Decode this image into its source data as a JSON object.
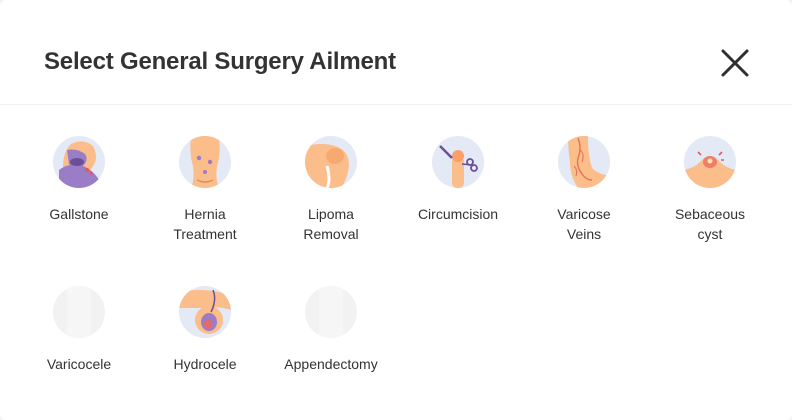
{
  "modal": {
    "title": "Select General Surgery Ailment",
    "close_icon": "close-icon"
  },
  "ailments": [
    {
      "label_lines": [
        "Gallstone"
      ],
      "icon": "gallstone-icon"
    },
    {
      "label_lines": [
        "Hernia",
        "Treatment"
      ],
      "icon": "hernia-icon"
    },
    {
      "label_lines": [
        "Lipoma",
        "Removal"
      ],
      "icon": "lipoma-icon"
    },
    {
      "label_lines": [
        "Circumcision"
      ],
      "icon": "circumcision-icon"
    },
    {
      "label_lines": [
        "Varicose",
        "Veins"
      ],
      "icon": "varicose-veins-icon"
    },
    {
      "label_lines": [
        "Sebaceous",
        "cyst"
      ],
      "icon": "sebaceous-cyst-icon"
    },
    {
      "label_lines": [
        "Varicocele"
      ],
      "icon": "varicocele-icon"
    },
    {
      "label_lines": [
        "Hydrocele"
      ],
      "icon": "hydrocele-icon"
    },
    {
      "label_lines": [
        "Appendectomy"
      ],
      "icon": "appendectomy-icon"
    }
  ],
  "colors": {
    "skin": "#fbbd8a",
    "circle_bg": "#e4e9f6",
    "purple": "#9b7cc6",
    "placeholder": "#f2f2f2"
  }
}
